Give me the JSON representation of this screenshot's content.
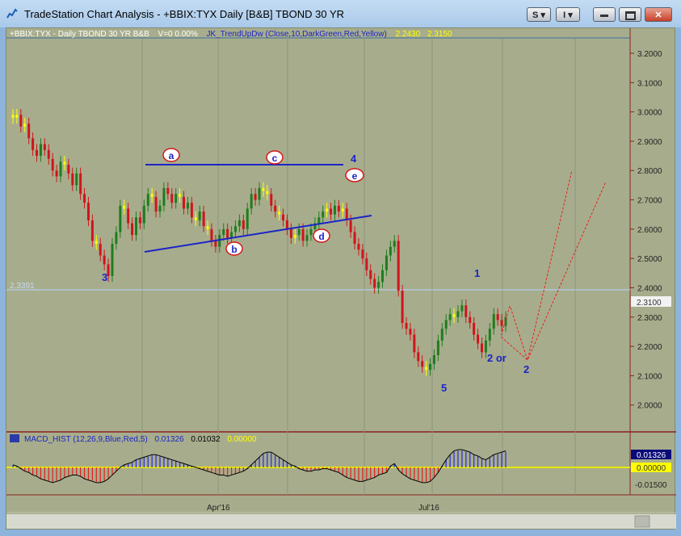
{
  "window": {
    "title": "TradeStation Chart Analysis - +BBIX:TYX Daily [B&B] TBOND 30 YR",
    "buttons": {
      "s": "S",
      "i": "I",
      "minimize": "",
      "restore": "",
      "close": ""
    }
  },
  "header": {
    "symbol_info": "+BBIX:TYX - Daily   TBOND 30 YR  B&B",
    "volume": "V=0  0.00%",
    "indicator": "JK_TrendUpDw (Close,10,DarkGreen,Red,Yellow)",
    "value1": "2.2430",
    "value2": "2.3150"
  },
  "price_axis": {
    "ticks": [
      "3.2000",
      "3.1000",
      "3.0000",
      "2.9000",
      "2.8000",
      "2.7000",
      "2.6000",
      "2.5000",
      "2.4000",
      "2.3000",
      "2.2000",
      "2.1000",
      "2.0000"
    ],
    "current_price": "2.3100",
    "hline_label": "2.3391"
  },
  "annotations": {
    "wave_a": "a",
    "wave_b": "b",
    "wave_c": "c",
    "wave_d": "d",
    "wave_e": "e",
    "wave_3": "3",
    "wave_4": "4",
    "wave_5": "5",
    "wave_1": "1",
    "wave_2or": "2 or",
    "wave_2": "2"
  },
  "macd": {
    "label": "MACD_HIST (12,26,9,Blue,Red,5)",
    "value1": "0.01326",
    "value2": "0.01032",
    "value3": "0.00000",
    "axis_current": "0.01326",
    "axis_zero": "0.00000",
    "axis_low": "-0.01500"
  },
  "time_axis": {
    "apr": "Apr'16",
    "jul": "Jul'16"
  },
  "colors": {
    "background": "#a7ad8c",
    "up": "#1e7d1e",
    "down": "#d0141c",
    "neutral": "#ffff00",
    "trendline": "#1c24c8",
    "macd_pos": "#2b2be0",
    "macd_neg": "#e02020"
  },
  "chart_data": {
    "type": "candlestick",
    "ylim": [
      1.98,
      3.25
    ],
    "closes": [
      2.98,
      2.99,
      2.95,
      2.96,
      2.91,
      2.87,
      2.85,
      2.89,
      2.87,
      2.84,
      2.8,
      2.78,
      2.83,
      2.82,
      2.79,
      2.75,
      2.79,
      2.72,
      2.69,
      2.63,
      2.56,
      2.55,
      2.51,
      2.48,
      2.44,
      2.55,
      2.59,
      2.68,
      2.67,
      2.62,
      2.58,
      2.64,
      2.62,
      2.68,
      2.72,
      2.71,
      2.66,
      2.68,
      2.74,
      2.72,
      2.69,
      2.72,
      2.71,
      2.67,
      2.69,
      2.64,
      2.63,
      2.66,
      2.61,
      2.6,
      2.56,
      2.54,
      2.58,
      2.6,
      2.57,
      2.59,
      2.61,
      2.63,
      2.6,
      2.67,
      2.72,
      2.7,
      2.74,
      2.73,
      2.72,
      2.68,
      2.66,
      2.65,
      2.63,
      2.6,
      2.57,
      2.58,
      2.6,
      2.56,
      2.58,
      2.6,
      2.62,
      2.64,
      2.66,
      2.67,
      2.65,
      2.68,
      2.66,
      2.67,
      2.63,
      2.59,
      2.55,
      2.53,
      2.5,
      2.46,
      2.43,
      2.4,
      2.42,
      2.46,
      2.51,
      2.54,
      2.56,
      2.39,
      2.28,
      2.26,
      2.24,
      2.18,
      2.15,
      2.13,
      2.12,
      2.14,
      2.17,
      2.22,
      2.26,
      2.29,
      2.31,
      2.3,
      2.32,
      2.34,
      2.3,
      2.28,
      2.24,
      2.21,
      2.18,
      2.22,
      2.26,
      2.31,
      2.29,
      2.27,
      2.3
    ],
    "macd_hist": [
      0.002,
      0.001,
      -0.001,
      -0.003,
      -0.004,
      -0.006,
      -0.007,
      -0.009,
      -0.01,
      -0.011,
      -0.012,
      -0.011,
      -0.01,
      -0.008,
      -0.007,
      -0.006,
      -0.006,
      -0.007,
      -0.009,
      -0.01,
      -0.011,
      -0.012,
      -0.012,
      -0.011,
      -0.009,
      -0.006,
      -0.003,
      0.0,
      0.002,
      0.003,
      0.004,
      0.006,
      0.007,
      0.008,
      0.009,
      0.01,
      0.01,
      0.009,
      0.008,
      0.007,
      0.006,
      0.005,
      0.004,
      0.003,
      0.002,
      0.001,
      0.0,
      -0.001,
      -0.002,
      -0.003,
      -0.004,
      -0.005,
      -0.006,
      -0.006,
      -0.007,
      -0.006,
      -0.005,
      -0.004,
      -0.003,
      -0.001,
      0.002,
      0.005,
      0.008,
      0.011,
      0.012,
      0.012,
      0.01,
      0.008,
      0.006,
      0.004,
      0.002,
      0.001,
      -0.001,
      -0.002,
      -0.003,
      -0.003,
      -0.002,
      -0.002,
      -0.001,
      -0.001,
      -0.002,
      -0.003,
      -0.004,
      -0.006,
      -0.008,
      -0.009,
      -0.01,
      -0.011,
      -0.011,
      -0.01,
      -0.009,
      -0.008,
      -0.006,
      -0.005,
      -0.004,
      0.001,
      0.003,
      -0.002,
      -0.005,
      -0.007,
      -0.009,
      -0.01,
      -0.011,
      -0.012,
      -0.012,
      -0.011,
      -0.008,
      -0.004,
      0.001,
      0.006,
      0.01,
      0.013,
      0.014,
      0.014,
      0.013,
      0.012,
      0.01,
      0.009,
      0.007,
      0.006,
      0.008,
      0.01,
      0.011,
      0.012,
      0.013
    ]
  }
}
